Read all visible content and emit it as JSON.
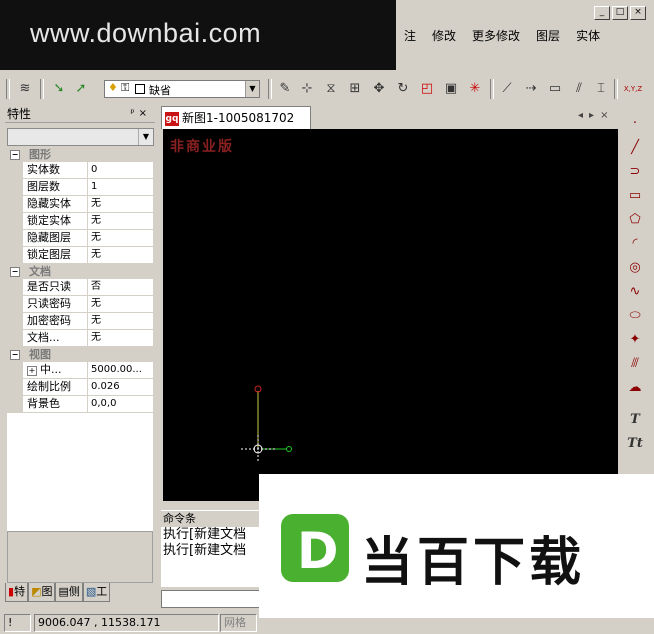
{
  "watermark_top": "www.downbai.com",
  "menu": [
    "注",
    "修改",
    "更多修改",
    "图层",
    "实体"
  ],
  "toolbar": {
    "layer_value": "缺省",
    "xyz_label": "X,Y,Z"
  },
  "properties": {
    "title": "特性",
    "pin_icon": "pin-icon",
    "categories": [
      {
        "name": "图形",
        "rows": [
          {
            "key": "实体数",
            "value": "0"
          },
          {
            "key": "图层数",
            "value": "1"
          },
          {
            "key": "隐藏实体",
            "value": "无"
          },
          {
            "key": "锁定实体",
            "value": "无"
          },
          {
            "key": "隐藏图层",
            "value": "无"
          },
          {
            "key": "锁定图层",
            "value": "无"
          }
        ]
      },
      {
        "name": "文档",
        "rows": [
          {
            "key": "是否只读",
            "value": "否"
          },
          {
            "key": "只读密码",
            "value": "无"
          },
          {
            "key": "加密密码",
            "value": "无"
          },
          {
            "key": "文档...",
            "value": "无"
          }
        ]
      },
      {
        "name": "视图",
        "rows": [
          {
            "key": "中...",
            "value": "5000.00..."
          },
          {
            "key": "绘制比例",
            "value": "0.026"
          },
          {
            "key": "背景色",
            "value": "0,0,0"
          }
        ]
      }
    ],
    "tabs": [
      "特",
      "图",
      "侧",
      "工"
    ]
  },
  "document": {
    "tab_title": "新图1-1005081702",
    "logo_text": "gq",
    "canvas_mark": "非商业版"
  },
  "command": {
    "title": "命令条",
    "lines": [
      "执行[新建文档",
      "执行[新建文档"
    ]
  },
  "status": {
    "indicator": "!",
    "coords": "9006.047 , 11538.171",
    "grid_label": "网格"
  },
  "watermark_bottom": {
    "logo_letter": "D",
    "text": "当百下载"
  },
  "colors": {
    "canvas": "#000000",
    "panel": "#d4d0c8",
    "brand_green": "#4ab02f",
    "axis_red": "#cc2222",
    "axis_green": "#22cc22"
  }
}
